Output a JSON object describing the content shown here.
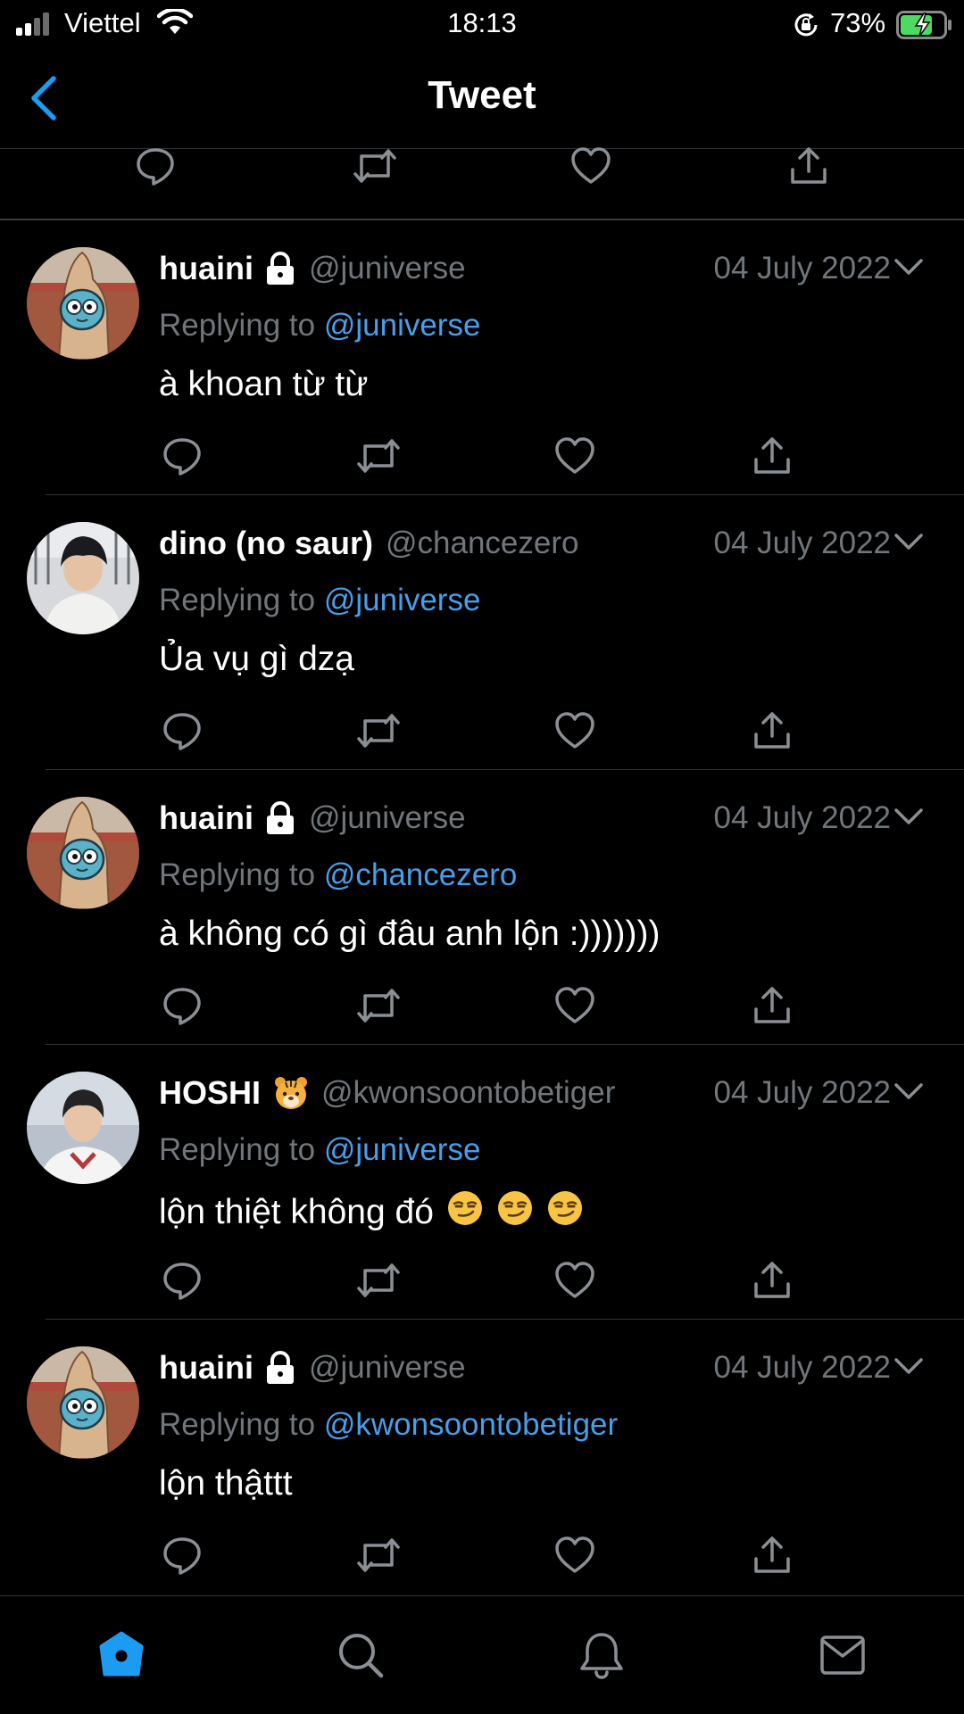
{
  "status_bar": {
    "carrier": "Viettel",
    "time": "18:13",
    "battery_percent": "73%",
    "battery_level": 0.73
  },
  "nav": {
    "title": "Tweet"
  },
  "replies": [
    {
      "name": "huaini",
      "locked": true,
      "handle": "@juniverse",
      "date": "04 July 2022",
      "replying_prefix": "Replying to ",
      "replying_to": "@juniverse",
      "text": "à khoan từ từ",
      "avatar": "gumball-avatar"
    },
    {
      "name": "dino (no saur)",
      "locked": false,
      "handle": "@chancezero",
      "date": "04 July 2022",
      "replying_prefix": "Replying to ",
      "replying_to": "@juniverse",
      "text": "Ủa vụ gì dzạ",
      "avatar": "photo-avatar"
    },
    {
      "name": "huaini",
      "locked": true,
      "handle": "@juniverse",
      "date": "04 July 2022",
      "replying_prefix": "Replying to ",
      "replying_to": "@chancezero",
      "text": "à không có gì đâu anh lộn :)))))))",
      "avatar": "gumball-avatar"
    },
    {
      "name": "HOSHI",
      "name_emoji": "tiger-face-emoji",
      "locked": false,
      "handle": "@kwonsoontobetiger",
      "date": "04 July 2022",
      "replying_prefix": "Replying to ",
      "replying_to": "@juniverse",
      "text": "lộn thiệt không đó",
      "text_emoji": [
        "smirking-face-emoji",
        "smirking-face-emoji",
        "smirking-face-emoji"
      ],
      "avatar": "photo-avatar"
    },
    {
      "name": "huaini",
      "locked": true,
      "handle": "@juniverse",
      "date": "04 July 2022",
      "replying_prefix": "Replying to ",
      "replying_to": "@kwonsoontobetiger",
      "text": "lộn thậttt",
      "avatar": "gumball-avatar"
    }
  ],
  "tab_bar": {
    "items": [
      "home-icon",
      "search-icon",
      "notifications-icon",
      "messages-icon"
    ],
    "active": "home-icon"
  },
  "colors": {
    "background": "#000000",
    "accent": "#1d9bf0",
    "mention": "#4a9de8",
    "muted": "#71767b",
    "battery": "#4cd964"
  }
}
